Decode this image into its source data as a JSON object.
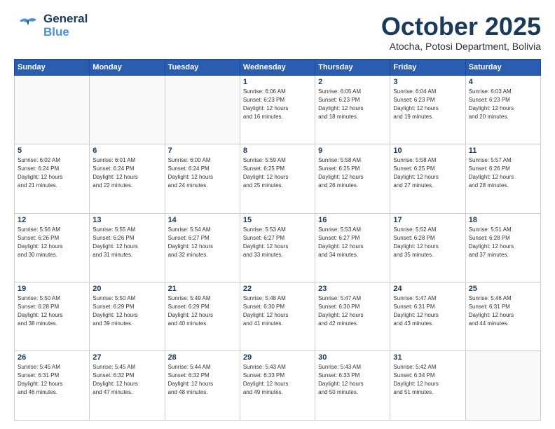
{
  "header": {
    "logo_general": "General",
    "logo_blue": "Blue",
    "month_title": "October 2025",
    "location": "Atocha, Potosi Department, Bolivia"
  },
  "days_of_week": [
    "Sunday",
    "Monday",
    "Tuesday",
    "Wednesday",
    "Thursday",
    "Friday",
    "Saturday"
  ],
  "weeks": [
    [
      {
        "day": "",
        "info": ""
      },
      {
        "day": "",
        "info": ""
      },
      {
        "day": "",
        "info": ""
      },
      {
        "day": "1",
        "info": "Sunrise: 6:06 AM\nSunset: 6:23 PM\nDaylight: 12 hours\nand 16 minutes."
      },
      {
        "day": "2",
        "info": "Sunrise: 6:05 AM\nSunset: 6:23 PM\nDaylight: 12 hours\nand 18 minutes."
      },
      {
        "day": "3",
        "info": "Sunrise: 6:04 AM\nSunset: 6:23 PM\nDaylight: 12 hours\nand 19 minutes."
      },
      {
        "day": "4",
        "info": "Sunrise: 6:03 AM\nSunset: 6:23 PM\nDaylight: 12 hours\nand 20 minutes."
      }
    ],
    [
      {
        "day": "5",
        "info": "Sunrise: 6:02 AM\nSunset: 6:24 PM\nDaylight: 12 hours\nand 21 minutes."
      },
      {
        "day": "6",
        "info": "Sunrise: 6:01 AM\nSunset: 6:24 PM\nDaylight: 12 hours\nand 22 minutes."
      },
      {
        "day": "7",
        "info": "Sunrise: 6:00 AM\nSunset: 6:24 PM\nDaylight: 12 hours\nand 24 minutes."
      },
      {
        "day": "8",
        "info": "Sunrise: 5:59 AM\nSunset: 6:25 PM\nDaylight: 12 hours\nand 25 minutes."
      },
      {
        "day": "9",
        "info": "Sunrise: 5:58 AM\nSunset: 6:25 PM\nDaylight: 12 hours\nand 26 minutes."
      },
      {
        "day": "10",
        "info": "Sunrise: 5:58 AM\nSunset: 6:25 PM\nDaylight: 12 hours\nand 27 minutes."
      },
      {
        "day": "11",
        "info": "Sunrise: 5:57 AM\nSunset: 6:26 PM\nDaylight: 12 hours\nand 28 minutes."
      }
    ],
    [
      {
        "day": "12",
        "info": "Sunrise: 5:56 AM\nSunset: 6:26 PM\nDaylight: 12 hours\nand 30 minutes."
      },
      {
        "day": "13",
        "info": "Sunrise: 5:55 AM\nSunset: 6:26 PM\nDaylight: 12 hours\nand 31 minutes."
      },
      {
        "day": "14",
        "info": "Sunrise: 5:54 AM\nSunset: 6:27 PM\nDaylight: 12 hours\nand 32 minutes."
      },
      {
        "day": "15",
        "info": "Sunrise: 5:53 AM\nSunset: 6:27 PM\nDaylight: 12 hours\nand 33 minutes."
      },
      {
        "day": "16",
        "info": "Sunrise: 5:53 AM\nSunset: 6:27 PM\nDaylight: 12 hours\nand 34 minutes."
      },
      {
        "day": "17",
        "info": "Sunrise: 5:52 AM\nSunset: 6:28 PM\nDaylight: 12 hours\nand 35 minutes."
      },
      {
        "day": "18",
        "info": "Sunrise: 5:51 AM\nSunset: 6:28 PM\nDaylight: 12 hours\nand 37 minutes."
      }
    ],
    [
      {
        "day": "19",
        "info": "Sunrise: 5:50 AM\nSunset: 6:28 PM\nDaylight: 12 hours\nand 38 minutes."
      },
      {
        "day": "20",
        "info": "Sunrise: 5:50 AM\nSunset: 6:29 PM\nDaylight: 12 hours\nand 39 minutes."
      },
      {
        "day": "21",
        "info": "Sunrise: 5:49 AM\nSunset: 6:29 PM\nDaylight: 12 hours\nand 40 minutes."
      },
      {
        "day": "22",
        "info": "Sunrise: 5:48 AM\nSunset: 6:30 PM\nDaylight: 12 hours\nand 41 minutes."
      },
      {
        "day": "23",
        "info": "Sunrise: 5:47 AM\nSunset: 6:30 PM\nDaylight: 12 hours\nand 42 minutes."
      },
      {
        "day": "24",
        "info": "Sunrise: 5:47 AM\nSunset: 6:31 PM\nDaylight: 12 hours\nand 43 minutes."
      },
      {
        "day": "25",
        "info": "Sunrise: 5:46 AM\nSunset: 6:31 PM\nDaylight: 12 hours\nand 44 minutes."
      }
    ],
    [
      {
        "day": "26",
        "info": "Sunrise: 5:45 AM\nSunset: 6:31 PM\nDaylight: 12 hours\nand 46 minutes."
      },
      {
        "day": "27",
        "info": "Sunrise: 5:45 AM\nSunset: 6:32 PM\nDaylight: 12 hours\nand 47 minutes."
      },
      {
        "day": "28",
        "info": "Sunrise: 5:44 AM\nSunset: 6:32 PM\nDaylight: 12 hours\nand 48 minutes."
      },
      {
        "day": "29",
        "info": "Sunrise: 5:43 AM\nSunset: 6:33 PM\nDaylight: 12 hours\nand 49 minutes."
      },
      {
        "day": "30",
        "info": "Sunrise: 5:43 AM\nSunset: 6:33 PM\nDaylight: 12 hours\nand 50 minutes."
      },
      {
        "day": "31",
        "info": "Sunrise: 5:42 AM\nSunset: 6:34 PM\nDaylight: 12 hours\nand 51 minutes."
      },
      {
        "day": "",
        "info": ""
      }
    ]
  ]
}
